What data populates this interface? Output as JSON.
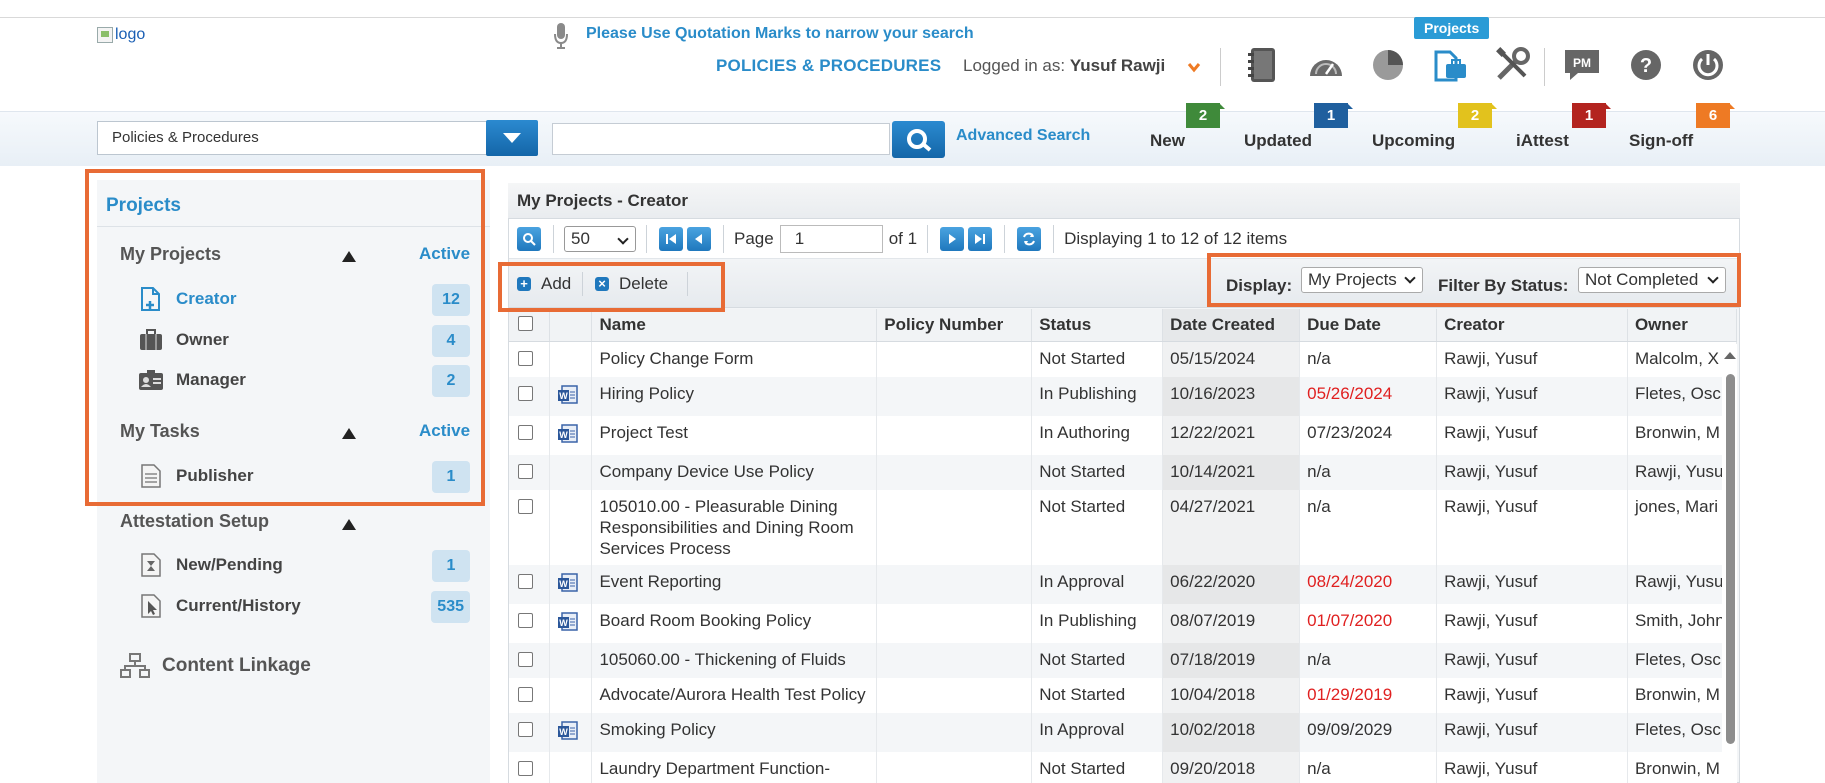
{
  "header": {
    "logo_alt": "logo",
    "search_tip": "Please Use Quotation Marks to narrow your search",
    "module_name": "POLICIES & PROCEDURES",
    "logged_in_label": "Logged in as:",
    "user_name": "Yusuf Rawji",
    "projects_tag": "Projects",
    "toolbar_icons": [
      "manual-icon",
      "dashboard-gauge-icon",
      "reports-pie-icon",
      "projects-icon",
      "tools-icon",
      "pm-messages-icon",
      "help-icon",
      "power-icon"
    ]
  },
  "search": {
    "module_value": "Policies & Procedures",
    "query_value": "",
    "advanced_label": "Advanced Search"
  },
  "quick_links": [
    {
      "label": "New",
      "count": "2",
      "color": "#3f8a3a"
    },
    {
      "label": "Updated",
      "count": "1",
      "color": "#1f5f9e"
    },
    {
      "label": "Upcoming",
      "count": "2",
      "color": "#e2c21d"
    },
    {
      "label": "iAttest",
      "count": "1",
      "color": "#b3241f"
    },
    {
      "label": "Sign-off",
      "count": "6",
      "color": "#ee7a24"
    }
  ],
  "sidebar": {
    "title": "Projects",
    "my_projects": {
      "label": "My Projects",
      "active_label": "Active",
      "items": [
        {
          "label": "Creator",
          "count": "12"
        },
        {
          "label": "Owner",
          "count": "4"
        },
        {
          "label": "Manager",
          "count": "2"
        }
      ]
    },
    "my_tasks": {
      "label": "My Tasks",
      "active_label": "Active",
      "items": [
        {
          "label": "Publisher",
          "count": "1"
        }
      ]
    },
    "attestation": {
      "label": "Attestation Setup",
      "items": [
        {
          "label": "New/Pending",
          "count": "1"
        },
        {
          "label": "Current/History",
          "count": "535"
        }
      ]
    },
    "content_linkage": "Content Linkage"
  },
  "main": {
    "title": "My Projects - Creator",
    "pager": {
      "page_size": "50",
      "page_label": "Page",
      "page_value": "1",
      "of_label": "of 1",
      "display_text": "Displaying 1 to 12 of 12 items"
    },
    "toolbar": {
      "add_label": "Add",
      "delete_label": "Delete",
      "display_label": "Display:",
      "display_value": "My Projects",
      "filter_label": "Filter By Status:",
      "filter_value": "Not Completed"
    },
    "columns": [
      "Name",
      "Policy Number",
      "Status",
      "Date Created",
      "Due Date",
      "Creator",
      "Owner"
    ],
    "rows": [
      {
        "doc": false,
        "name": "Policy Change Form",
        "policy_number": "",
        "status": "Not Started",
        "created": "05/15/2024",
        "due": "n/a",
        "due_late": false,
        "creator": "Rawji, Yusuf",
        "owner": "Malcolm, X"
      },
      {
        "doc": true,
        "name": "Hiring Policy",
        "policy_number": "",
        "status": "In Publishing",
        "created": "10/16/2023",
        "due": "05/26/2024",
        "due_late": true,
        "creator": "Rawji, Yusuf",
        "owner": "Fletes, Osc"
      },
      {
        "doc": true,
        "name": "Project Test",
        "policy_number": "",
        "status": "In Authoring",
        "created": "12/22/2021",
        "due": "07/23/2024",
        "due_late": false,
        "creator": "Rawji, Yusuf",
        "owner": "Bronwin, M"
      },
      {
        "doc": false,
        "name": "Company Device Use Policy",
        "policy_number": "",
        "status": "Not Started",
        "created": "10/14/2021",
        "due": "n/a",
        "due_late": false,
        "creator": "Rawji, Yusuf",
        "owner": "Rawji, Yusu"
      },
      {
        "doc": false,
        "name": "105010.00 - Pleasurable Dining Responsibilities and Dining Room Services Process",
        "policy_number": "",
        "status": "Not Started",
        "created": "04/27/2021",
        "due": "n/a",
        "due_late": false,
        "creator": "Rawji, Yusuf",
        "owner": "jones, Mari"
      },
      {
        "doc": true,
        "name": "Event Reporting",
        "policy_number": "",
        "status": "In Approval",
        "created": "06/22/2020",
        "due": "08/24/2020",
        "due_late": true,
        "creator": "Rawji, Yusuf",
        "owner": "Rawji, Yusu"
      },
      {
        "doc": true,
        "name": "Board Room Booking Policy",
        "policy_number": "",
        "status": "In Publishing",
        "created": "08/07/2019",
        "due": "01/07/2020",
        "due_late": true,
        "creator": "Rawji, Yusuf",
        "owner": "Smith, John"
      },
      {
        "doc": false,
        "name": "105060.00 - Thickening of Fluids",
        "policy_number": "",
        "status": "Not Started",
        "created": "07/18/2019",
        "due": "n/a",
        "due_late": false,
        "creator": "Rawji, Yusuf",
        "owner": "Fletes, Osc"
      },
      {
        "doc": false,
        "name": "Advocate/Aurora Health Test Policy",
        "policy_number": "",
        "status": "Not Started",
        "created": "10/04/2018",
        "due": "01/29/2019",
        "due_late": true,
        "creator": "Rawji, Yusuf",
        "owner": "Bronwin, M"
      },
      {
        "doc": true,
        "name": "Smoking Policy",
        "policy_number": "",
        "status": "In Approval",
        "created": "10/02/2018",
        "due": "09/09/2029",
        "due_late": false,
        "creator": "Rawji, Yusuf",
        "owner": "Fletes, Osc"
      },
      {
        "doc": false,
        "name": "Laundry Department Function-",
        "policy_number": "",
        "status": "Not Started",
        "created": "09/20/2018",
        "due": "n/a",
        "due_late": false,
        "creator": "Rawji, Yusuf",
        "owner": "Bronwin, M"
      }
    ]
  },
  "colors": {
    "accent": "#2a8cc9",
    "highlight": "#e86b35",
    "overdue": "#e02020"
  }
}
